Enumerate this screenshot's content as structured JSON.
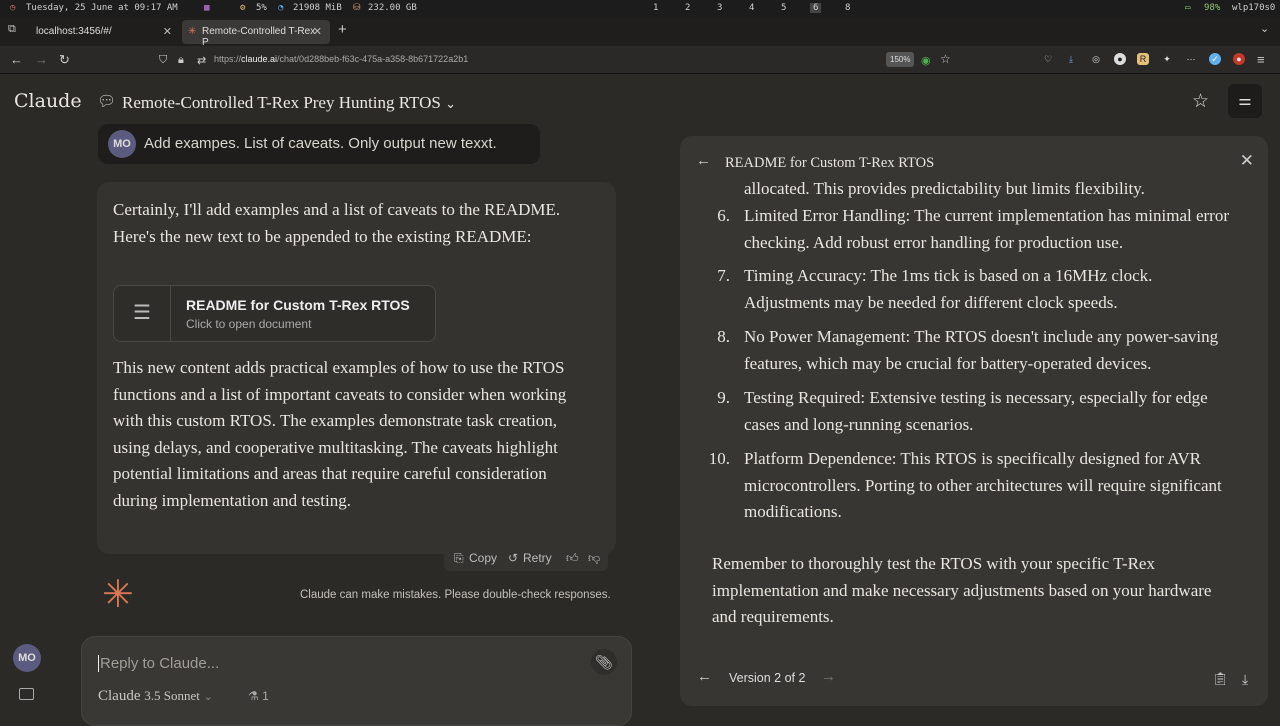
{
  "system_bar": {
    "datetime": "Tuesday, 25 June at 09:17 AM",
    "cpu": "5%",
    "memory": "21908 MiB",
    "disk": "232.00 GB",
    "workspaces": [
      "1",
      "2",
      "3",
      "4",
      "5",
      "6",
      "8"
    ],
    "active_workspace": "6",
    "battery": "98%",
    "network": "wlp170s0"
  },
  "browser": {
    "tabs": [
      {
        "title": "localhost:3456/#/",
        "active": false
      },
      {
        "title": "Remote-Controlled T-Rex P",
        "active": true
      }
    ],
    "url_prefix": "https://",
    "url_domain": "claude.ai",
    "url_path": "/chat/0d288beb-f63c-475a-a358-8b671722a2b1",
    "zoom": "150%"
  },
  "app": {
    "logo": "Claude",
    "chat_title": "Remote-Controlled T-Rex Prey Hunting RTOS",
    "user_initials": "MO"
  },
  "conversation": {
    "user_message": "Add exampes. List of caveats. Only output new texxt.",
    "assistant_intro": "Certainly, I'll add examples and a list of caveats to the README. Here's the new text to be appended to the existing README:",
    "artifact_card": {
      "title": "README for Custom T-Rex RTOS",
      "subtitle": "Click to open document"
    },
    "assistant_outro": "This new content adds practical examples of how to use the RTOS functions and a list of important caveats to consider when working with this custom RTOS. The examples demonstrate task creation, using delays, and cooperative multitasking. The caveats highlight potential limitations and areas that require careful consideration during implementation and testing.",
    "actions": {
      "copy": "Copy",
      "retry": "Retry"
    },
    "disclaimer": "Claude can make mistakes. Please double-check responses."
  },
  "composer": {
    "placeholder": "Reply to Claude...",
    "model_name": "Claude",
    "model_version": "3.5 Sonnet",
    "project_count": "1"
  },
  "artifact_panel": {
    "title": "README for Custom T-Rex RTOS",
    "partial_line": "allocated. This provides predictability but limits flexibility.",
    "items": [
      {
        "num": "6.",
        "text": "Limited Error Handling: The current implementation has minimal error checking. Add robust error handling for production use."
      },
      {
        "num": "7.",
        "text": "Timing Accuracy: The 1ms tick is based on a 16MHz clock. Adjustments may be needed for different clock speeds."
      },
      {
        "num": "8.",
        "text": "No Power Management: The RTOS doesn't include any power-saving features, which may be crucial for battery-operated devices."
      },
      {
        "num": "9.",
        "text": "Testing Required: Extensive testing is necessary, especially for edge cases and long-running scenarios."
      },
      {
        "num": "10.",
        "text": "Platform Dependence: This RTOS is specifically designed for AVR microcontrollers. Porting to other architectures will require significant modifications."
      }
    ],
    "closing": "Remember to thoroughly test the RTOS with your specific T-Rex implementation and make necessary adjustments based on your hardware and requirements.",
    "version_label": "Version 2 of 2"
  }
}
